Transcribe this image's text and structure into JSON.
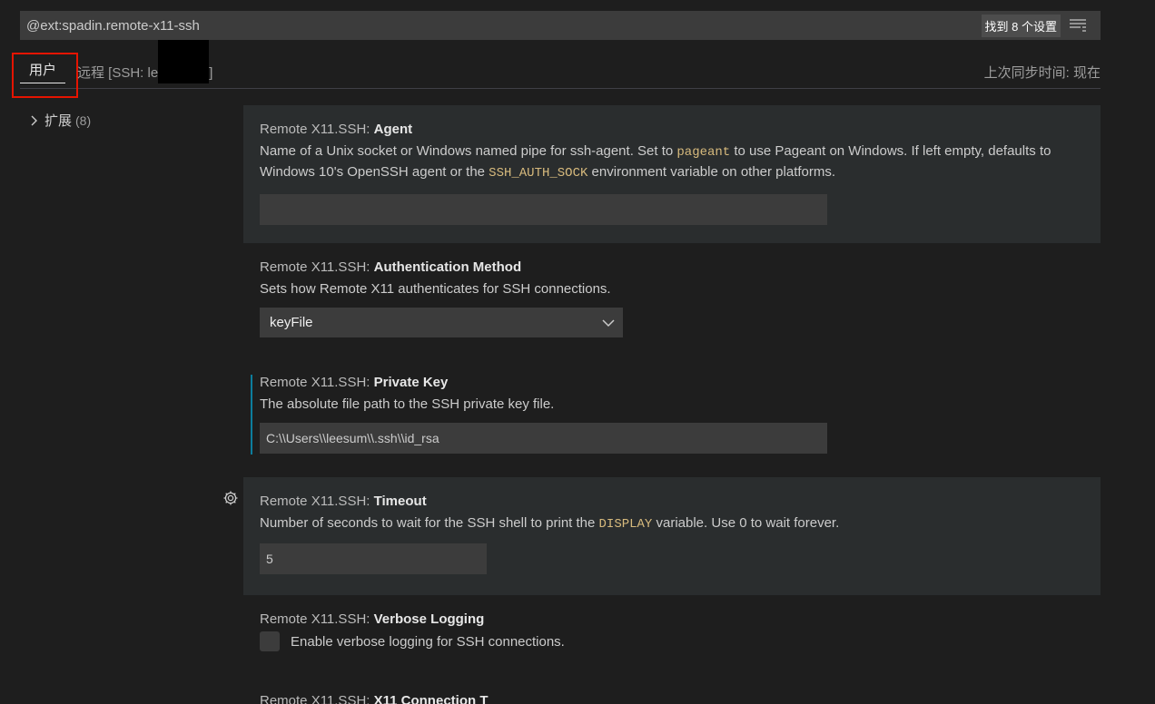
{
  "search": {
    "value": "@ext:spadin.remote-x11-ssh",
    "count_label": "找到 8 个设置"
  },
  "tabs": {
    "user_label": "用户",
    "remote_prefix": "远程 [SSH: le",
    "remote_suffix": "]",
    "sync_status": "上次同步时间: 现在"
  },
  "tree": {
    "label": "扩展",
    "count": "(8)"
  },
  "settings": {
    "agent": {
      "category": "Remote X11.SSH: ",
      "name": "Agent",
      "desc_1": "Name of a Unix socket or Windows named pipe for ssh-agent. Set to ",
      "code_1": "pageant",
      "desc_2": " to use Pageant on Windows. If left empty, defaults to Windows 10's OpenSSH agent or the ",
      "code_2": "SSH_AUTH_SOCK",
      "desc_3": " environment variable on other platforms.",
      "value": ""
    },
    "auth_method": {
      "category": "Remote X11.SSH: ",
      "name": "Authentication Method",
      "desc": "Sets how Remote X11 authenticates for SSH connections.",
      "selected": "keyFile"
    },
    "private_key": {
      "category": "Remote X11.SSH: ",
      "name": "Private Key",
      "desc": "The absolute file path to the SSH private key file.",
      "value": "C:\\\\Users\\\\leesum\\\\.ssh\\\\id_rsa"
    },
    "timeout": {
      "category": "Remote X11.SSH: ",
      "name": "Timeout",
      "desc_1": "Number of seconds to wait for the SSH shell to print the ",
      "code": "DISPLAY",
      "desc_2": " variable. Use 0 to wait forever.",
      "value": "5"
    },
    "verbose": {
      "category": "Remote X11.SSH: ",
      "name": "Verbose Logging",
      "checkbox_label": "Enable verbose logging for SSH connections.",
      "checked": false
    },
    "next_partial": {
      "category": "Remote X11.SSH: ",
      "name": "X11 Connection T"
    }
  },
  "colors": {
    "background": "#1e1e1e",
    "highlight_row": "#2a2d2e",
    "input": "#3c3c3c",
    "code": "#d7ba7d",
    "annotation_box": "#e51400",
    "modified_indicator": "#0c7d9d"
  }
}
